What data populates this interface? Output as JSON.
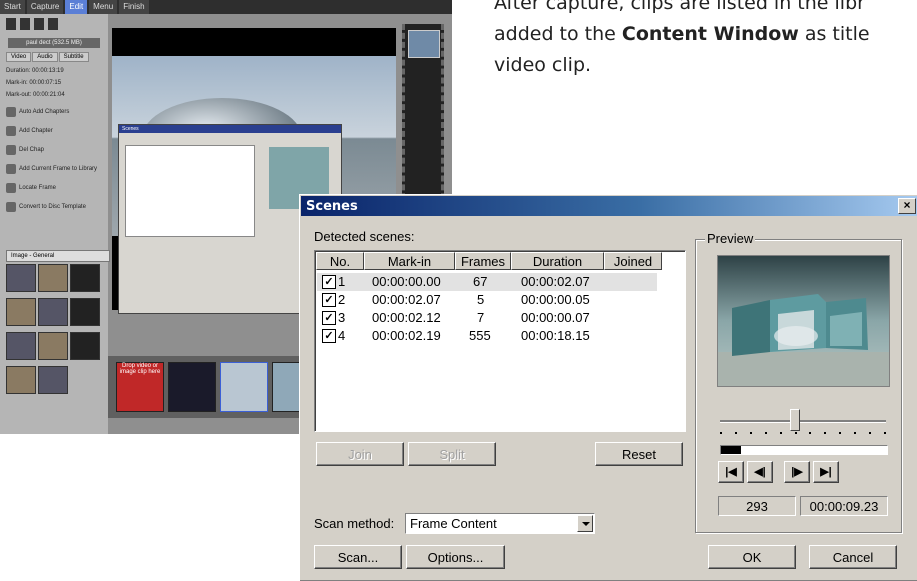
{
  "caption": {
    "line1": "After capture, clips are listed in the libr",
    "line2_prefix": "added to the ",
    "line2_bold": "Content Window",
    "line2_suffix": " as title",
    "line3": "video clip."
  },
  "background_app": {
    "menu": [
      "Start",
      "Capture",
      "Edit",
      "Menu",
      "Finish"
    ],
    "active_menu_index": 2,
    "title_strip": "paul dect (532.5 MB)",
    "tabs": [
      "Video",
      "Audio",
      "Subtitle"
    ],
    "info": [
      "Duration: 00:00:13:19",
      "Mark-in: 00:00:07:15",
      "Mark-out: 00:00:21:04"
    ],
    "actions": [
      "Auto Add Chapters",
      "Add Chapter",
      "Del Chap",
      "Add Current Frame to Library",
      "Locate Frame",
      "Convert to Disc Template"
    ],
    "library_label": "Image - General",
    "drop_text": "Drop video or image clip here"
  },
  "dialog": {
    "title": "Scenes",
    "close_glyph": "×",
    "detected_label": "Detected scenes:",
    "columns": [
      "No.",
      "Mark-in",
      "Frames",
      "Duration",
      "Joined"
    ],
    "rows": [
      {
        "no": "1",
        "mark_in": "00:00:00.00",
        "frames": "67",
        "duration": "00:00:02.07",
        "checked": true,
        "selected": true
      },
      {
        "no": "2",
        "mark_in": "00:00:02.07",
        "frames": "5",
        "duration": "00:00:00.05",
        "checked": true,
        "selected": false
      },
      {
        "no": "3",
        "mark_in": "00:00:02.12",
        "frames": "7",
        "duration": "00:00:00.07",
        "checked": true,
        "selected": false
      },
      {
        "no": "4",
        "mark_in": "00:00:02.19",
        "frames": "555",
        "duration": "00:00:18.15",
        "checked": true,
        "selected": false
      }
    ],
    "join_label": "Join",
    "split_label": "Split",
    "reset_label": "Reset",
    "scan_method_label": "Scan method:",
    "scan_method_value": "Frame Content",
    "scan_label": "Scan...",
    "options_label": "Options...",
    "preview_label": "Preview",
    "frame_number": "293",
    "timecode": "00:00:09.23",
    "ok_label": "OK",
    "cancel_label": "Cancel",
    "slider_position": 0.45,
    "progress_fraction": 0.12,
    "nav_icons": [
      "first-frame-icon",
      "prev-frame-icon",
      "next-frame-icon",
      "last-frame-icon"
    ],
    "nav_glyphs": [
      "|◀",
      "◀|",
      "|▶",
      "▶|"
    ]
  }
}
